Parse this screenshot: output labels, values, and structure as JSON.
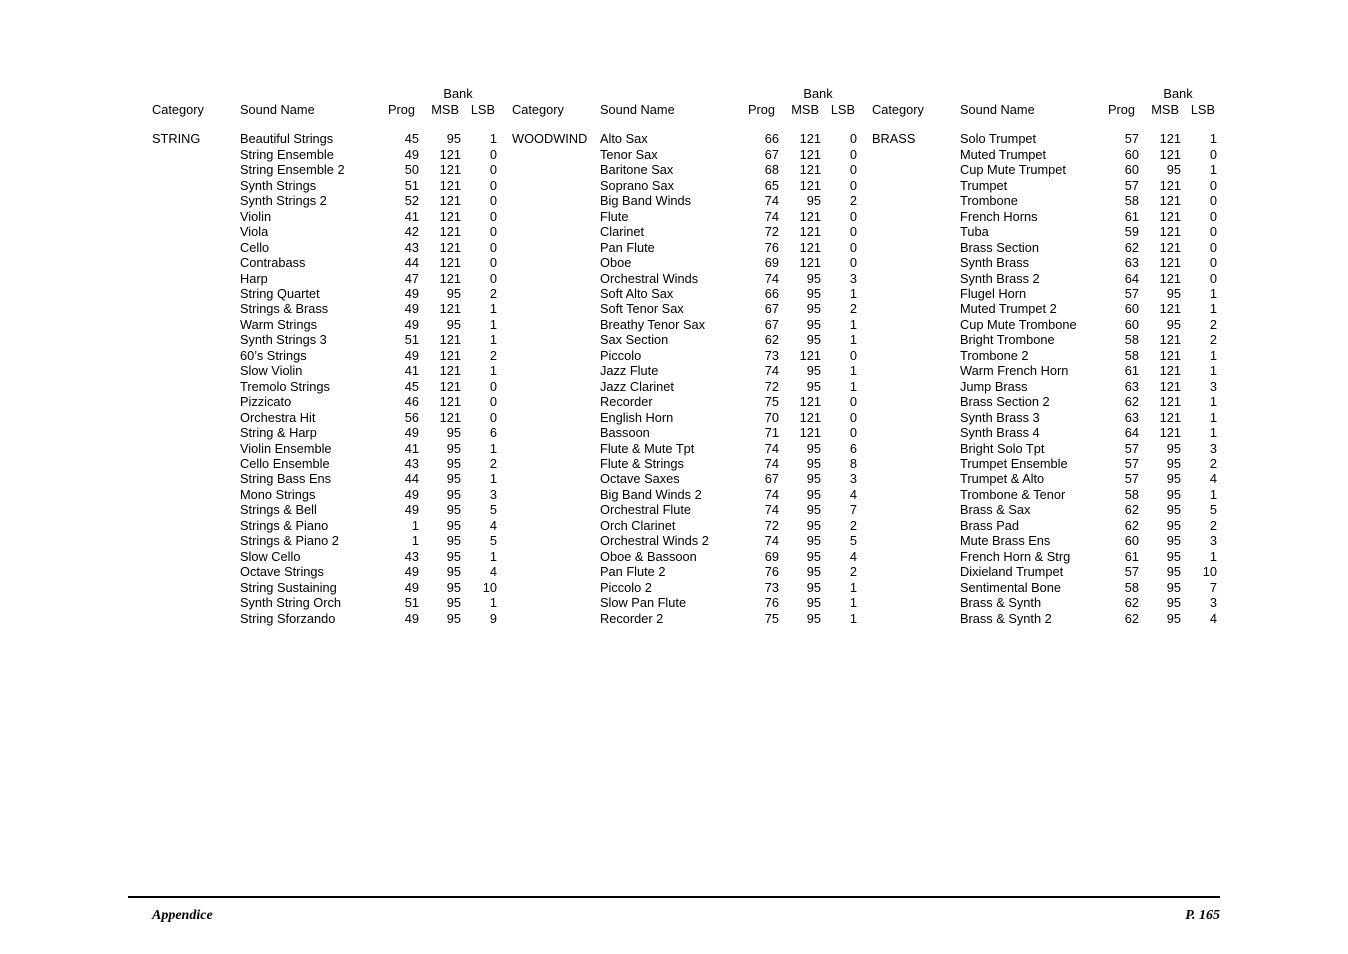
{
  "footer": {
    "section_label": "Appendice",
    "page_label": "P. 165"
  },
  "table_headers": {
    "category": "Category",
    "sound_name": "Sound Name",
    "prog": "Prog",
    "bank": "Bank",
    "msb": "MSB",
    "lsb": "LSB"
  },
  "columns": [
    {
      "category": "STRING",
      "rows": [
        {
          "name": "Beautiful Strings",
          "prog": "45",
          "msb": "95",
          "lsb": "1"
        },
        {
          "name": "String Ensemble",
          "prog": "49",
          "msb": "121",
          "lsb": "0"
        },
        {
          "name": "String Ensemble 2",
          "prog": "50",
          "msb": "121",
          "lsb": "0"
        },
        {
          "name": "Synth Strings",
          "prog": "51",
          "msb": "121",
          "lsb": "0"
        },
        {
          "name": "Synth Strings 2",
          "prog": "52",
          "msb": "121",
          "lsb": "0"
        },
        {
          "name": "Violin",
          "prog": "41",
          "msb": "121",
          "lsb": "0"
        },
        {
          "name": "Viola",
          "prog": "42",
          "msb": "121",
          "lsb": "0"
        },
        {
          "name": "Cello",
          "prog": "43",
          "msb": "121",
          "lsb": "0"
        },
        {
          "name": "Contrabass",
          "prog": "44",
          "msb": "121",
          "lsb": "0"
        },
        {
          "name": "Harp",
          "prog": "47",
          "msb": "121",
          "lsb": "0"
        },
        {
          "name": "String Quartet",
          "prog": "49",
          "msb": "95",
          "lsb": "2"
        },
        {
          "name": "Strings & Brass",
          "prog": "49",
          "msb": "121",
          "lsb": "1"
        },
        {
          "name": "Warm Strings",
          "prog": "49",
          "msb": "95",
          "lsb": "1"
        },
        {
          "name": "Synth Strings 3",
          "prog": "51",
          "msb": "121",
          "lsb": "1"
        },
        {
          "name": "60’s Strings",
          "prog": "49",
          "msb": "121",
          "lsb": "2"
        },
        {
          "name": "Slow Violin",
          "prog": "41",
          "msb": "121",
          "lsb": "1"
        },
        {
          "name": "Tremolo Strings",
          "prog": "45",
          "msb": "121",
          "lsb": "0"
        },
        {
          "name": "Pizzicato",
          "prog": "46",
          "msb": "121",
          "lsb": "0"
        },
        {
          "name": "Orchestra Hit",
          "prog": "56",
          "msb": "121",
          "lsb": "0"
        },
        {
          "name": "String & Harp",
          "prog": "49",
          "msb": "95",
          "lsb": "6"
        },
        {
          "name": "Violin Ensemble",
          "prog": "41",
          "msb": "95",
          "lsb": "1"
        },
        {
          "name": "Cello Ensemble",
          "prog": "43",
          "msb": "95",
          "lsb": "2"
        },
        {
          "name": "String Bass Ens",
          "prog": "44",
          "msb": "95",
          "lsb": "1"
        },
        {
          "name": "Mono Strings",
          "prog": "49",
          "msb": "95",
          "lsb": "3"
        },
        {
          "name": "Strings & Bell",
          "prog": "49",
          "msb": "95",
          "lsb": "5"
        },
        {
          "name": "Strings & Piano",
          "prog": "1",
          "msb": "95",
          "lsb": "4"
        },
        {
          "name": "Strings & Piano 2",
          "prog": "1",
          "msb": "95",
          "lsb": "5"
        },
        {
          "name": "Slow Cello",
          "prog": "43",
          "msb": "95",
          "lsb": "1"
        },
        {
          "name": "Octave Strings",
          "prog": "49",
          "msb": "95",
          "lsb": "4"
        },
        {
          "name": "String Sustaining",
          "prog": "49",
          "msb": "95",
          "lsb": "10"
        },
        {
          "name": "Synth String Orch",
          "prog": "51",
          "msb": "95",
          "lsb": "1"
        },
        {
          "name": "String Sforzando",
          "prog": "49",
          "msb": "95",
          "lsb": "9"
        }
      ]
    },
    {
      "category": "WOODWIND",
      "rows": [
        {
          "name": "Alto Sax",
          "prog": "66",
          "msb": "121",
          "lsb": "0"
        },
        {
          "name": "Tenor Sax",
          "prog": "67",
          "msb": "121",
          "lsb": "0"
        },
        {
          "name": "Baritone Sax",
          "prog": "68",
          "msb": "121",
          "lsb": "0"
        },
        {
          "name": "Soprano Sax",
          "prog": "65",
          "msb": "121",
          "lsb": "0"
        },
        {
          "name": "Big Band Winds",
          "prog": "74",
          "msb": "95",
          "lsb": "2"
        },
        {
          "name": "Flute",
          "prog": "74",
          "msb": "121",
          "lsb": "0"
        },
        {
          "name": "Clarinet",
          "prog": "72",
          "msb": "121",
          "lsb": "0"
        },
        {
          "name": "Pan Flute",
          "prog": "76",
          "msb": "121",
          "lsb": "0"
        },
        {
          "name": "Oboe",
          "prog": "69",
          "msb": "121",
          "lsb": "0"
        },
        {
          "name": "Orchestral Winds",
          "prog": "74",
          "msb": "95",
          "lsb": "3"
        },
        {
          "name": "Soft Alto Sax",
          "prog": "66",
          "msb": "95",
          "lsb": "1"
        },
        {
          "name": "Soft Tenor Sax",
          "prog": "67",
          "msb": "95",
          "lsb": "2"
        },
        {
          "name": "Breathy Tenor Sax",
          "prog": "67",
          "msb": "95",
          "lsb": "1"
        },
        {
          "name": "Sax Section",
          "prog": "62",
          "msb": "95",
          "lsb": "1"
        },
        {
          "name": "Piccolo",
          "prog": "73",
          "msb": "121",
          "lsb": "0"
        },
        {
          "name": "Jazz Flute",
          "prog": "74",
          "msb": "95",
          "lsb": "1"
        },
        {
          "name": "Jazz Clarinet",
          "prog": "72",
          "msb": "95",
          "lsb": "1"
        },
        {
          "name": "Recorder",
          "prog": "75",
          "msb": "121",
          "lsb": "0"
        },
        {
          "name": "English Horn",
          "prog": "70",
          "msb": "121",
          "lsb": "0"
        },
        {
          "name": "Bassoon",
          "prog": "71",
          "msb": "121",
          "lsb": "0"
        },
        {
          "name": "Flute & Mute Tpt",
          "prog": "74",
          "msb": "95",
          "lsb": "6"
        },
        {
          "name": "Flute & Strings",
          "prog": "74",
          "msb": "95",
          "lsb": "8"
        },
        {
          "name": "Octave Saxes",
          "prog": "67",
          "msb": "95",
          "lsb": "3"
        },
        {
          "name": "Big Band Winds 2",
          "prog": "74",
          "msb": "95",
          "lsb": "4"
        },
        {
          "name": "Orchestral Flute",
          "prog": "74",
          "msb": "95",
          "lsb": "7"
        },
        {
          "name": "Orch Clarinet",
          "prog": "72",
          "msb": "95",
          "lsb": "2"
        },
        {
          "name": "Orchestral Winds 2",
          "prog": "74",
          "msb": "95",
          "lsb": "5"
        },
        {
          "name": "Oboe & Bassoon",
          "prog": "69",
          "msb": "95",
          "lsb": "4"
        },
        {
          "name": "Pan Flute 2",
          "prog": "76",
          "msb": "95",
          "lsb": "2"
        },
        {
          "name": "Piccolo 2",
          "prog": "73",
          "msb": "95",
          "lsb": "1"
        },
        {
          "name": "Slow Pan Flute",
          "prog": "76",
          "msb": "95",
          "lsb": "1"
        },
        {
          "name": "Recorder 2",
          "prog": "75",
          "msb": "95",
          "lsb": "1"
        }
      ]
    },
    {
      "category": "BRASS",
      "rows": [
        {
          "name": "Solo Trumpet",
          "prog": "57",
          "msb": "121",
          "lsb": "1"
        },
        {
          "name": "Muted Trumpet",
          "prog": "60",
          "msb": "121",
          "lsb": "0"
        },
        {
          "name": "Cup Mute Trumpet",
          "prog": "60",
          "msb": "95",
          "lsb": "1"
        },
        {
          "name": "Trumpet",
          "prog": "57",
          "msb": "121",
          "lsb": "0"
        },
        {
          "name": "Trombone",
          "prog": "58",
          "msb": "121",
          "lsb": "0"
        },
        {
          "name": "French Horns",
          "prog": "61",
          "msb": "121",
          "lsb": "0"
        },
        {
          "name": "Tuba",
          "prog": "59",
          "msb": "121",
          "lsb": "0"
        },
        {
          "name": "Brass Section",
          "prog": "62",
          "msb": "121",
          "lsb": "0"
        },
        {
          "name": "Synth Brass",
          "prog": "63",
          "msb": "121",
          "lsb": "0"
        },
        {
          "name": "Synth Brass 2",
          "prog": "64",
          "msb": "121",
          "lsb": "0"
        },
        {
          "name": "Flugel Horn",
          "prog": "57",
          "msb": "95",
          "lsb": "1"
        },
        {
          "name": "Muted Trumpet 2",
          "prog": "60",
          "msb": "121",
          "lsb": "1"
        },
        {
          "name": "Cup Mute Trombone",
          "prog": "60",
          "msb": "95",
          "lsb": "2"
        },
        {
          "name": "Bright Trombone",
          "prog": "58",
          "msb": "121",
          "lsb": "2"
        },
        {
          "name": "Trombone 2",
          "prog": "58",
          "msb": "121",
          "lsb": "1"
        },
        {
          "name": "Warm French Horn",
          "prog": "61",
          "msb": "121",
          "lsb": "1"
        },
        {
          "name": "Jump Brass",
          "prog": "63",
          "msb": "121",
          "lsb": "3"
        },
        {
          "name": "Brass Section 2",
          "prog": "62",
          "msb": "121",
          "lsb": "1"
        },
        {
          "name": "Synth Brass 3",
          "prog": "63",
          "msb": "121",
          "lsb": "1"
        },
        {
          "name": "Synth Brass 4",
          "prog": "64",
          "msb": "121",
          "lsb": "1"
        },
        {
          "name": "Bright Solo Tpt",
          "prog": "57",
          "msb": "95",
          "lsb": "3"
        },
        {
          "name": "Trumpet Ensemble",
          "prog": "57",
          "msb": "95",
          "lsb": "2"
        },
        {
          "name": "Trumpet & Alto",
          "prog": "57",
          "msb": "95",
          "lsb": "4"
        },
        {
          "name": "Trombone & Tenor",
          "prog": "58",
          "msb": "95",
          "lsb": "1"
        },
        {
          "name": "Brass & Sax",
          "prog": "62",
          "msb": "95",
          "lsb": "5"
        },
        {
          "name": "Brass Pad",
          "prog": "62",
          "msb": "95",
          "lsb": "2"
        },
        {
          "name": "Mute Brass Ens",
          "prog": "60",
          "msb": "95",
          "lsb": "3"
        },
        {
          "name": "French Horn & Strg",
          "prog": "61",
          "msb": "95",
          "lsb": "1"
        },
        {
          "name": "Dixieland Trumpet",
          "prog": "57",
          "msb": "95",
          "lsb": "10"
        },
        {
          "name": "Sentimental Bone",
          "prog": "58",
          "msb": "95",
          "lsb": "7"
        },
        {
          "name": "Brass & Synth",
          "prog": "62",
          "msb": "95",
          "lsb": "3"
        },
        {
          "name": "Brass & Synth 2",
          "prog": "62",
          "msb": "95",
          "lsb": "4"
        }
      ]
    }
  ]
}
